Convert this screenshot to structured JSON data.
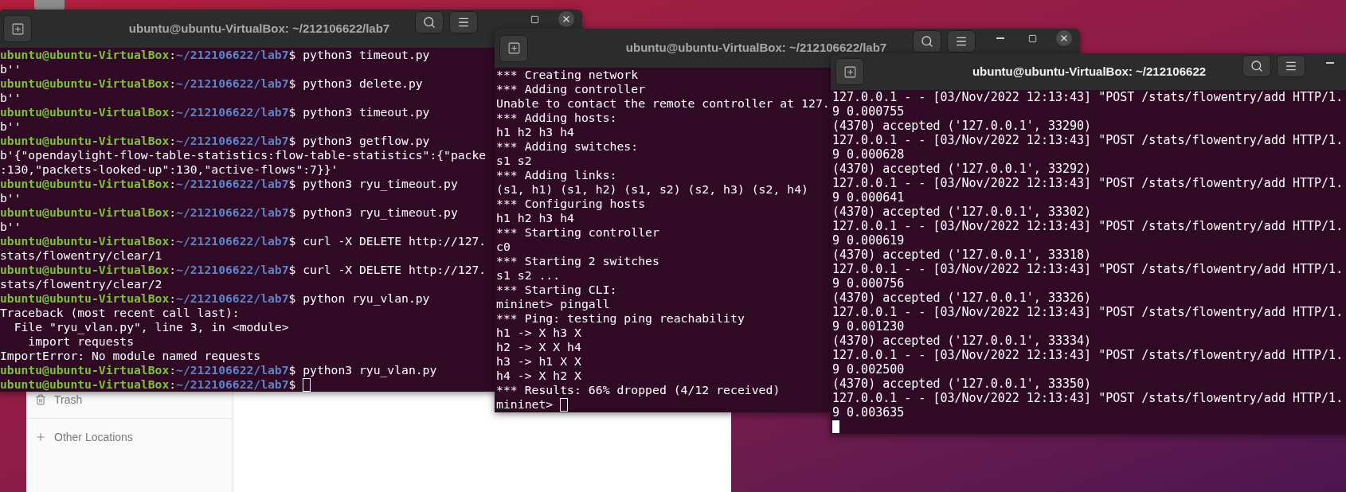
{
  "file_manager": {
    "sidebar": [
      {
        "kind": "trash",
        "label": "Trash"
      },
      {
        "kind": "other",
        "label": "Other Locations"
      }
    ]
  },
  "windows": [
    {
      "title": "ubuntu@ubuntu-VirtualBox: ~/212106622/lab7",
      "focused": false,
      "lines": [
        {
          "kind": "prompt",
          "user": "ubuntu@ubuntu-VirtualBox",
          "sep": ":",
          "path": "~/212106622/lab7",
          "command": "$ python3 timeout.py"
        },
        {
          "kind": "output",
          "text": "b''"
        },
        {
          "kind": "prompt",
          "user": "ubuntu@ubuntu-VirtualBox",
          "sep": ":",
          "path": "~/212106622/lab7",
          "command": "$ python3 delete.py"
        },
        {
          "kind": "output",
          "text": "b''"
        },
        {
          "kind": "prompt",
          "user": "ubuntu@ubuntu-VirtualBox",
          "sep": ":",
          "path": "~/212106622/lab7",
          "command": "$ python3 timeout.py"
        },
        {
          "kind": "output",
          "text": "b''"
        },
        {
          "kind": "prompt",
          "user": "ubuntu@ubuntu-VirtualBox",
          "sep": ":",
          "path": "~/212106622/lab7",
          "command": "$ python3 getflow.py"
        },
        {
          "kind": "output",
          "text": "b'{\"opendaylight-flow-table-statistics:flow-table-statistics\":{\"packe"
        },
        {
          "kind": "output",
          "text": ":130,\"packets-looked-up\":130,\"active-flows\":7}}'"
        },
        {
          "kind": "prompt",
          "user": "ubuntu@ubuntu-VirtualBox",
          "sep": ":",
          "path": "~/212106622/lab7",
          "command": "$ python3 ryu_timeout.py"
        },
        {
          "kind": "output",
          "text": "b''"
        },
        {
          "kind": "prompt",
          "user": "ubuntu@ubuntu-VirtualBox",
          "sep": ":",
          "path": "~/212106622/lab7",
          "command": "$ python3 ryu_timeout.py"
        },
        {
          "kind": "output",
          "text": "b''"
        },
        {
          "kind": "prompt",
          "user": "ubuntu@ubuntu-VirtualBox",
          "sep": ":",
          "path": "~/212106622/lab7",
          "command": "$ curl -X DELETE http://127."
        },
        {
          "kind": "output",
          "text": "stats/flowentry/clear/1"
        },
        {
          "kind": "prompt",
          "user": "ubuntu@ubuntu-VirtualBox",
          "sep": ":",
          "path": "~/212106622/lab7",
          "command": "$ curl -X DELETE http://127."
        },
        {
          "kind": "output",
          "text": "stats/flowentry/clear/2"
        },
        {
          "kind": "prompt",
          "user": "ubuntu@ubuntu-VirtualBox",
          "sep": ":",
          "path": "~/212106622/lab7",
          "command": "$ python ryu_vlan.py"
        },
        {
          "kind": "output",
          "text": "Traceback (most recent call last):"
        },
        {
          "kind": "output",
          "text": "  File \"ryu_vlan.py\", line 3, in <module>"
        },
        {
          "kind": "output",
          "text": "    import requests"
        },
        {
          "kind": "output",
          "text": "ImportError: No module named requests"
        },
        {
          "kind": "prompt",
          "user": "ubuntu@ubuntu-VirtualBox",
          "sep": ":",
          "path": "~/212106622/lab7",
          "command": "$ python3 ryu_vlan.py"
        },
        {
          "kind": "prompt",
          "user": "ubuntu@ubuntu-VirtualBox",
          "sep": ":",
          "path": "~/212106622/lab7",
          "command": "$",
          "cursor": true
        }
      ]
    },
    {
      "title": "ubuntu@ubuntu-VirtualBox: ~/212106622/lab7",
      "focused": false,
      "lines": [
        {
          "kind": "output",
          "text": "*** Creating network"
        },
        {
          "kind": "output",
          "text": "*** Adding controller"
        },
        {
          "kind": "output",
          "text": "Unable to contact the remote controller at 127."
        },
        {
          "kind": "output",
          "text": "*** Adding hosts:"
        },
        {
          "kind": "output",
          "text": "h1 h2 h3 h4"
        },
        {
          "kind": "output",
          "text": "*** Adding switches:"
        },
        {
          "kind": "output",
          "text": "s1 s2"
        },
        {
          "kind": "output",
          "text": "*** Adding links:"
        },
        {
          "kind": "output",
          "text": "(s1, h1) (s1, h2) (s1, s2) (s2, h3) (s2, h4)"
        },
        {
          "kind": "output",
          "text": "*** Configuring hosts"
        },
        {
          "kind": "output",
          "text": "h1 h2 h3 h4"
        },
        {
          "kind": "output",
          "text": "*** Starting controller"
        },
        {
          "kind": "output",
          "text": "c0"
        },
        {
          "kind": "output",
          "text": "*** Starting 2 switches"
        },
        {
          "kind": "output",
          "text": "s1 s2 ..."
        },
        {
          "kind": "output",
          "text": "*** Starting CLI:"
        },
        {
          "kind": "output",
          "text": "mininet> pingall"
        },
        {
          "kind": "output",
          "text": "*** Ping: testing ping reachability"
        },
        {
          "kind": "output",
          "text": "h1 -> X h3 X"
        },
        {
          "kind": "output",
          "text": "h2 -> X X h4"
        },
        {
          "kind": "output",
          "text": "h3 -> h1 X X"
        },
        {
          "kind": "output",
          "text": "h4 -> X h2 X"
        },
        {
          "kind": "output",
          "text": "*** Results: 66% dropped (4/12 received)"
        },
        {
          "kind": "output",
          "text": "mininet>",
          "cursor": true
        }
      ]
    },
    {
      "title": "ubuntu@ubuntu-VirtualBox: ~/212106622",
      "focused": true,
      "lines": [
        {
          "kind": "output",
          "text": "127.0.0.1 - - [03/Nov/2022 12:13:43] \"POST /stats/flowentry/add HTTP/1."
        },
        {
          "kind": "output",
          "text": "9 0.000755"
        },
        {
          "kind": "output",
          "text": "(4370) accepted ('127.0.0.1', 33290)"
        },
        {
          "kind": "output",
          "text": "127.0.0.1 - - [03/Nov/2022 12:13:43] \"POST /stats/flowentry/add HTTP/1."
        },
        {
          "kind": "output",
          "text": "9 0.000628"
        },
        {
          "kind": "output",
          "text": "(4370) accepted ('127.0.0.1', 33292)"
        },
        {
          "kind": "output",
          "text": "127.0.0.1 - - [03/Nov/2022 12:13:43] \"POST /stats/flowentry/add HTTP/1."
        },
        {
          "kind": "output",
          "text": "9 0.000641"
        },
        {
          "kind": "output",
          "text": "(4370) accepted ('127.0.0.1', 33302)"
        },
        {
          "kind": "output",
          "text": "127.0.0.1 - - [03/Nov/2022 12:13:43] \"POST /stats/flowentry/add HTTP/1."
        },
        {
          "kind": "output",
          "text": "9 0.000619"
        },
        {
          "kind": "output",
          "text": "(4370) accepted ('127.0.0.1', 33318)"
        },
        {
          "kind": "output",
          "text": "127.0.0.1 - - [03/Nov/2022 12:13:43] \"POST /stats/flowentry/add HTTP/1."
        },
        {
          "kind": "output",
          "text": "9 0.000756"
        },
        {
          "kind": "output",
          "text": "(4370) accepted ('127.0.0.1', 33326)"
        },
        {
          "kind": "output",
          "text": "127.0.0.1 - - [03/Nov/2022 12:13:43] \"POST /stats/flowentry/add HTTP/1."
        },
        {
          "kind": "output",
          "text": "9 0.001230"
        },
        {
          "kind": "output",
          "text": "(4370) accepted ('127.0.0.1', 33334)"
        },
        {
          "kind": "output",
          "text": "127.0.0.1 - - [03/Nov/2022 12:13:43] \"POST /stats/flowentry/add HTTP/1."
        },
        {
          "kind": "output",
          "text": "9 0.002500"
        },
        {
          "kind": "output",
          "text": "(4370) accepted ('127.0.0.1', 33350)"
        },
        {
          "kind": "output",
          "text": "127.0.0.1 - - [03/Nov/2022 12:13:43] \"POST /stats/flowentry/add HTTP/1."
        },
        {
          "kind": "output",
          "text": "9 0.003635"
        },
        {
          "kind": "cursor",
          "cursor": true
        }
      ]
    }
  ]
}
